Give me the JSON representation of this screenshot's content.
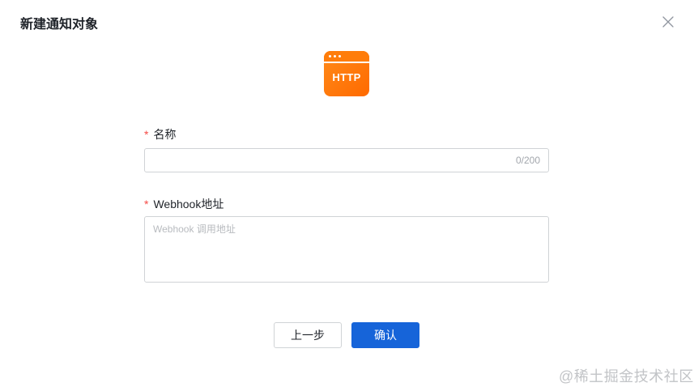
{
  "dialog": {
    "title": "新建通知对象",
    "close_icon": "close-icon"
  },
  "channel_icon": {
    "label": "HTTP",
    "colors": {
      "top": "#ff8a1a",
      "bottom": "#ff6a00"
    }
  },
  "form": {
    "name": {
      "required_mark": "*",
      "label": "名称",
      "value": "",
      "counter": "0/200"
    },
    "webhook": {
      "required_mark": "*",
      "label": "Webhook地址",
      "value": "",
      "placeholder": "Webhook 调用地址"
    }
  },
  "actions": {
    "prev_label": "上一步",
    "confirm_label": "确认"
  },
  "watermark": "@稀土掘金技术社区",
  "colors": {
    "primary": "#1664d9",
    "required": "#f54a45",
    "border": "#d0d3d6"
  }
}
